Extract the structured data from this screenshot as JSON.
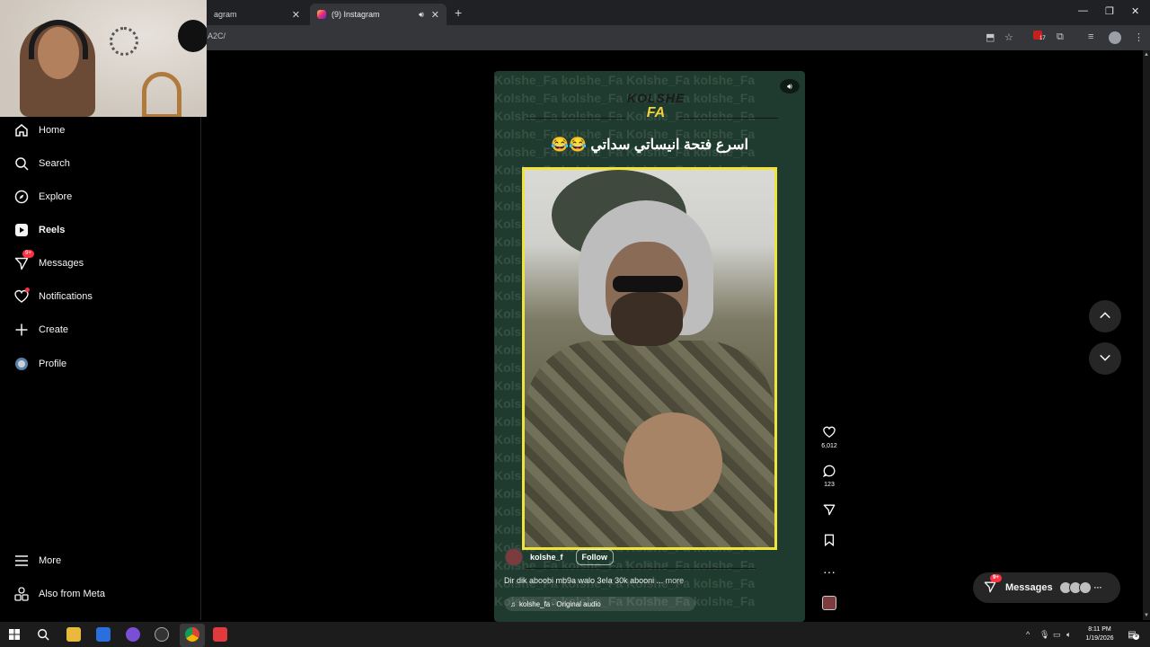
{
  "browser": {
    "tabs": [
      {
        "label": "agram",
        "active": false
      },
      {
        "label": "(9) Instagram",
        "active": true
      }
    ],
    "address": "A2C/",
    "extension_badge": "17"
  },
  "sidebar": {
    "items": [
      {
        "label": "Home",
        "icon": "home-icon"
      },
      {
        "label": "Search",
        "icon": "search-icon"
      },
      {
        "label": "Explore",
        "icon": "compass-icon"
      },
      {
        "label": "Reels",
        "icon": "reels-icon",
        "active": true
      },
      {
        "label": "Messages",
        "icon": "direct-icon",
        "badge": "9+"
      },
      {
        "label": "Notifications",
        "icon": "heart-icon",
        "dot": true
      },
      {
        "label": "Create",
        "icon": "plus-icon"
      },
      {
        "label": "Profile",
        "icon": "profile-avatar-icon"
      }
    ],
    "more_label": "More",
    "meta_label": "Also from Meta"
  },
  "reel": {
    "brand_line1": "KOLSHE",
    "brand_line2": "FA",
    "headline": "اسرع فتحة انيساتي سداتي 😂😂",
    "watermark_text": "Kolshe_Fa kolshe_Fa Kolshe_Fa kolshe_Fa",
    "author": "kolshe_f",
    "follow_label": "Follow",
    "caption": "Dir dik aboobi mb9a walo 3ela 30k abooni ...",
    "caption_more": "more",
    "audio": "kolshe_fa · Original audio",
    "likes": "6,012",
    "comments": "123"
  },
  "messages_pill": {
    "label": "Messages",
    "badge": "9+"
  },
  "taskbar": {
    "time": "8:11 PM",
    "date": "1/19/2026",
    "notif_count": "9"
  },
  "colors": {
    "accent_red": "#ff3040",
    "reel_bg": "#1f3a2e",
    "photo_border": "#f0e33a"
  }
}
